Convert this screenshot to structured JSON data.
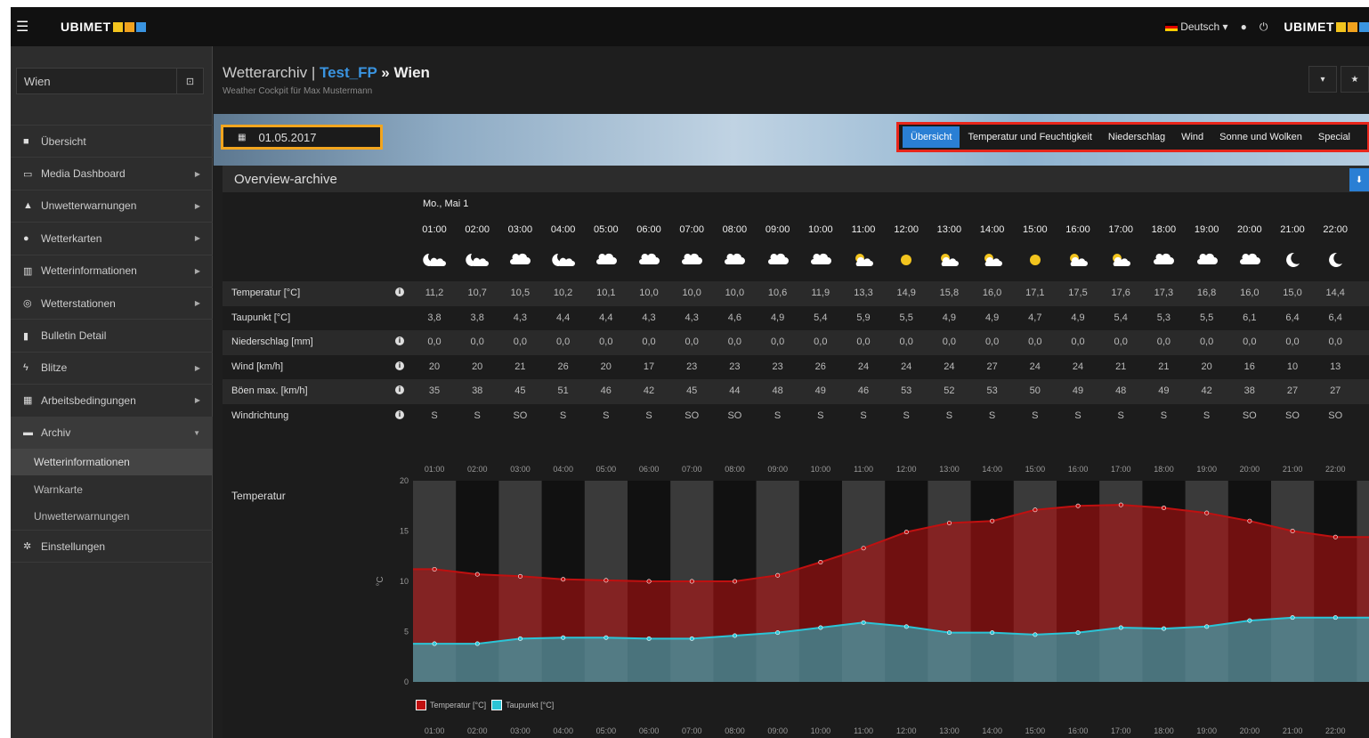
{
  "topbar": {
    "menu_icon": "hamburger-icon",
    "brand": "UBIMET",
    "brand_squares": [
      "#f2c41e",
      "#f0a21e",
      "#3a94e0"
    ],
    "language": "Deutsch",
    "user_icon": "user-icon",
    "power_icon": "power-icon"
  },
  "sidebar": {
    "search_value": "Wien",
    "items": [
      {
        "label": "Übersicht",
        "icon": "grid-icon",
        "arrow": false
      },
      {
        "label": "Media Dashboard",
        "icon": "monitor-icon",
        "arrow": true
      },
      {
        "label": "Unwetterwarnungen",
        "icon": "warning-icon",
        "arrow": true
      },
      {
        "label": "Wetterkarten",
        "icon": "globe-icon",
        "arrow": true
      },
      {
        "label": "Wetterinformationen",
        "icon": "bar-chart-icon",
        "arrow": true
      },
      {
        "label": "Wetterstationen",
        "icon": "target-icon",
        "arrow": true
      },
      {
        "label": "Bulletin Detail",
        "icon": "flag-icon",
        "arrow": false
      },
      {
        "label": "Blitze",
        "icon": "lightning-icon",
        "arrow": true
      },
      {
        "label": "Arbeitsbedingungen",
        "icon": "table-icon",
        "arrow": true
      },
      {
        "label": "Archiv",
        "icon": "archive-icon",
        "arrow": true,
        "active": true
      }
    ],
    "subitems": [
      "Wetterinformationen",
      "Warnkarte",
      "Unwetterwarnungen"
    ],
    "settings": "Einstellungen"
  },
  "main": {
    "title_prefix": "Wetterarchiv | ",
    "title_project": "Test_FP",
    "title_sep": " » ",
    "title_city": "Wien",
    "subtitle": "Weather Cockpit für Max Mustermann",
    "date": "01.05.2017",
    "tabs": [
      "Übersicht",
      "Temperatur und Feuchtigkeit",
      "Niederschlag",
      "Wind",
      "Sonne und Wolken",
      "Special"
    ],
    "panel_title": "Overview-archive",
    "day": "Mo., Mai 1",
    "hours": [
      "01:00",
      "02:00",
      "03:00",
      "04:00",
      "05:00",
      "06:00",
      "07:00",
      "08:00",
      "09:00",
      "10:00",
      "11:00",
      "12:00",
      "13:00",
      "14:00",
      "15:00",
      "16:00",
      "17:00",
      "18:00",
      "19:00",
      "20:00",
      "21:00",
      "22:00"
    ],
    "weather_icons": [
      "moon-cloud",
      "moon-cloud",
      "cloud",
      "moon-cloud",
      "cloud",
      "cloud",
      "cloud",
      "cloud",
      "cloud",
      "cloud",
      "sun-cloud",
      "sun",
      "sun-cloud",
      "sun-cloud",
      "sun",
      "sun-cloud",
      "sun-cloud",
      "cloud",
      "cloud",
      "cloud",
      "moon",
      "moon"
    ],
    "rows": [
      {
        "label": "Temperatur [°C]",
        "info": true,
        "values": [
          "11,2",
          "10,7",
          "10,5",
          "10,2",
          "10,1",
          "10,0",
          "10,0",
          "10,0",
          "10,6",
          "11,9",
          "13,3",
          "14,9",
          "15,8",
          "16,0",
          "17,1",
          "17,5",
          "17,6",
          "17,3",
          "16,8",
          "16,0",
          "15,0",
          "14,4"
        ]
      },
      {
        "label": "Taupunkt [°C]",
        "info": false,
        "values": [
          "3,8",
          "3,8",
          "4,3",
          "4,4",
          "4,4",
          "4,3",
          "4,3",
          "4,6",
          "4,9",
          "5,4",
          "5,9",
          "5,5",
          "4,9",
          "4,9",
          "4,7",
          "4,9",
          "5,4",
          "5,3",
          "5,5",
          "6,1",
          "6,4",
          "6,4"
        ]
      },
      {
        "label": "Niederschlag [mm]",
        "info": true,
        "values": [
          "0,0",
          "0,0",
          "0,0",
          "0,0",
          "0,0",
          "0,0",
          "0,0",
          "0,0",
          "0,0",
          "0,0",
          "0,0",
          "0,0",
          "0,0",
          "0,0",
          "0,0",
          "0,0",
          "0,0",
          "0,0",
          "0,0",
          "0,0",
          "0,0",
          "0,0"
        ]
      },
      {
        "label": "Wind [km/h]",
        "info": true,
        "values": [
          "20",
          "20",
          "21",
          "26",
          "20",
          "17",
          "23",
          "23",
          "23",
          "26",
          "24",
          "24",
          "24",
          "27",
          "24",
          "24",
          "21",
          "21",
          "20",
          "16",
          "10",
          "13"
        ]
      },
      {
        "label": "Böen max. [km/h]",
        "info": true,
        "values": [
          "35",
          "38",
          "45",
          "51",
          "46",
          "42",
          "45",
          "44",
          "48",
          "49",
          "46",
          "53",
          "52",
          "53",
          "50",
          "49",
          "48",
          "49",
          "42",
          "38",
          "27",
          "27"
        ]
      },
      {
        "label": "Windrichtung",
        "info": true,
        "values": [
          "S",
          "S",
          "SO",
          "S",
          "S",
          "S",
          "SO",
          "SO",
          "S",
          "S",
          "S",
          "S",
          "S",
          "S",
          "S",
          "S",
          "S",
          "S",
          "S",
          "SO",
          "SO",
          "SO"
        ]
      }
    ],
    "chart_label": "Temperatur"
  },
  "chart_data": {
    "type": "area",
    "x": [
      "01:00",
      "02:00",
      "03:00",
      "04:00",
      "05:00",
      "06:00",
      "07:00",
      "08:00",
      "09:00",
      "10:00",
      "11:00",
      "12:00",
      "13:00",
      "14:00",
      "15:00",
      "16:00",
      "17:00",
      "18:00",
      "19:00",
      "20:00",
      "21:00",
      "22:00"
    ],
    "series": [
      {
        "name": "Temperatur [°C]",
        "color": "#c01010",
        "values": [
          11.2,
          10.7,
          10.5,
          10.2,
          10.1,
          10.0,
          10.0,
          10.0,
          10.6,
          11.9,
          13.3,
          14.9,
          15.8,
          16.0,
          17.1,
          17.5,
          17.6,
          17.3,
          16.8,
          16.0,
          15.0,
          14.4
        ]
      },
      {
        "name": "Taupunkt [°C]",
        "color": "#2bc4d6",
        "values": [
          3.8,
          3.8,
          4.3,
          4.4,
          4.4,
          4.3,
          4.3,
          4.6,
          4.9,
          5.4,
          5.9,
          5.5,
          4.9,
          4.9,
          4.7,
          4.9,
          5.4,
          5.3,
          5.5,
          6.1,
          6.4,
          6.4
        ]
      }
    ],
    "ylabel": "°C",
    "ylim": [
      0,
      20
    ],
    "yticks": [
      0,
      5,
      10,
      15,
      20
    ],
    "grid": "alternating-hour-bands"
  }
}
